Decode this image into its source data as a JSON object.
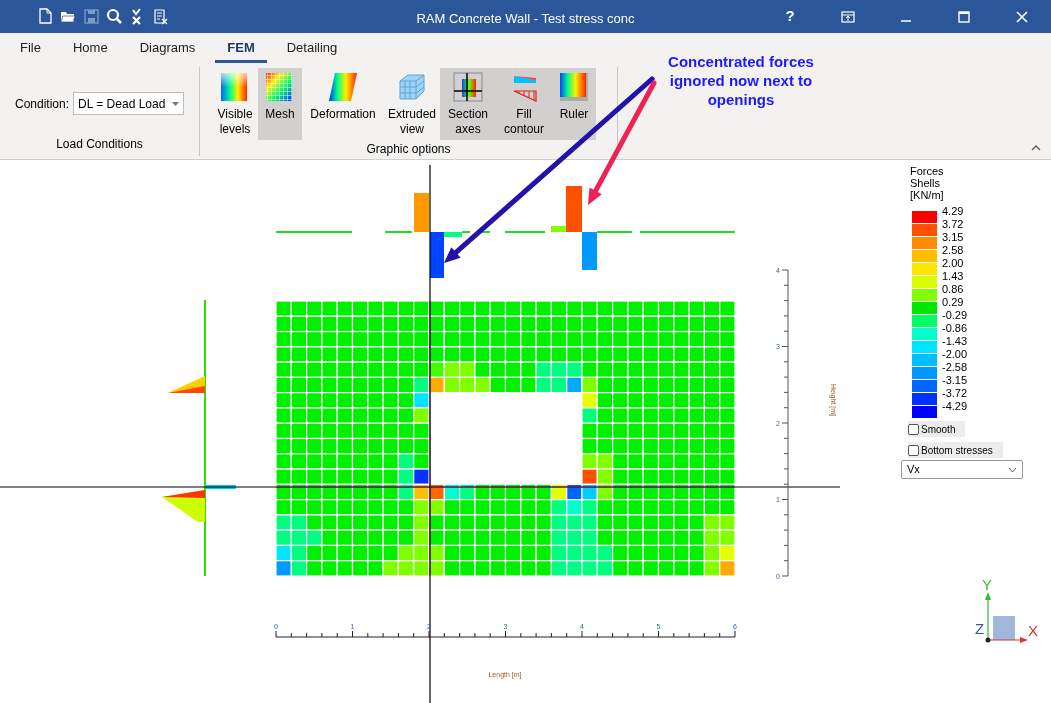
{
  "window": {
    "title": "RAM Concrete Wall - Test stress conc",
    "quick_access": [
      {
        "kind": "new",
        "disabled": false
      },
      {
        "kind": "open",
        "disabled": false
      },
      {
        "kind": "save",
        "disabled": true
      },
      {
        "kind": "query",
        "disabled": false
      },
      {
        "kind": "check",
        "disabled": false
      },
      {
        "kind": "report",
        "disabled": false
      }
    ],
    "controls": [
      {
        "kind": "help",
        "label": "?"
      },
      {
        "kind": "ribbon-display"
      },
      {
        "kind": "minimize"
      },
      {
        "kind": "maximize"
      },
      {
        "kind": "close"
      }
    ]
  },
  "ribbon": {
    "tabs": [
      {
        "label": "File",
        "selected": false
      },
      {
        "label": "Home",
        "selected": false
      },
      {
        "label": "Diagrams",
        "selected": false
      },
      {
        "label": "FEM",
        "selected": true
      },
      {
        "label": "Detailing",
        "selected": false
      }
    ],
    "load_conditions": {
      "title": "Load Conditions",
      "label": "Condition:",
      "value": "DL = Dead Load"
    },
    "graphic_options": {
      "title": "Graphic options",
      "buttons": [
        {
          "kind": "levels",
          "label": "Visible levels",
          "selected": false
        },
        {
          "kind": "mesh",
          "label": "Mesh",
          "selected": true
        },
        {
          "kind": "deformation",
          "label": "Deformation",
          "selected": false
        },
        {
          "kind": "extruded",
          "label": "Extruded view",
          "selected": false
        },
        {
          "kind": "section",
          "label": "Section axes",
          "selected": true
        },
        {
          "kind": "fill",
          "label": "Fill contour",
          "selected": true
        },
        {
          "kind": "ruler",
          "label": "Ruler",
          "selected": true
        }
      ]
    }
  },
  "annotation": {
    "text": "Concentrated forces ignored now next to openings"
  },
  "plot": {
    "x_axis": {
      "ticks": [
        "0",
        "1",
        "2",
        "3",
        "4",
        "5",
        "6"
      ],
      "title": "Length [m]"
    },
    "y_axis": {
      "ticks": [
        "4",
        "3",
        "2",
        "1",
        "0"
      ],
      "title": "Height [m]"
    },
    "triad": {
      "x": "X",
      "y": "Y",
      "z": "Z"
    }
  },
  "legend": {
    "title_lines": [
      "Forces",
      "Shells",
      "[KN/m]"
    ],
    "swatches": [
      {
        "color": "#ff0000"
      },
      {
        "color": "#ff4f00"
      },
      {
        "color": "#ff8c00"
      },
      {
        "color": "#ffbf00"
      },
      {
        "color": "#ffe600"
      },
      {
        "color": "#d9ff00"
      },
      {
        "color": "#80ff00"
      },
      {
        "color": "#00e600"
      },
      {
        "color": "#00ff66"
      },
      {
        "color": "#00ffcc"
      },
      {
        "color": "#00e5ff"
      },
      {
        "color": "#00bfff"
      },
      {
        "color": "#0099ff"
      },
      {
        "color": "#0066ff"
      },
      {
        "color": "#0033ff"
      },
      {
        "color": "#0000ff"
      }
    ],
    "values": [
      "4.29",
      "3.72",
      "3.15",
      "2.58",
      "2.00",
      "1.43",
      "0.86",
      "0.29",
      "-0.29",
      "-0.86",
      "-1.43",
      "-2.00",
      "-2.58",
      "-3.15",
      "-3.72",
      "-4.29"
    ],
    "options": [
      {
        "label": "Smooth",
        "checked": false
      },
      {
        "label": "Bottom stresses",
        "checked": false
      }
    ],
    "component": "Vx"
  }
}
